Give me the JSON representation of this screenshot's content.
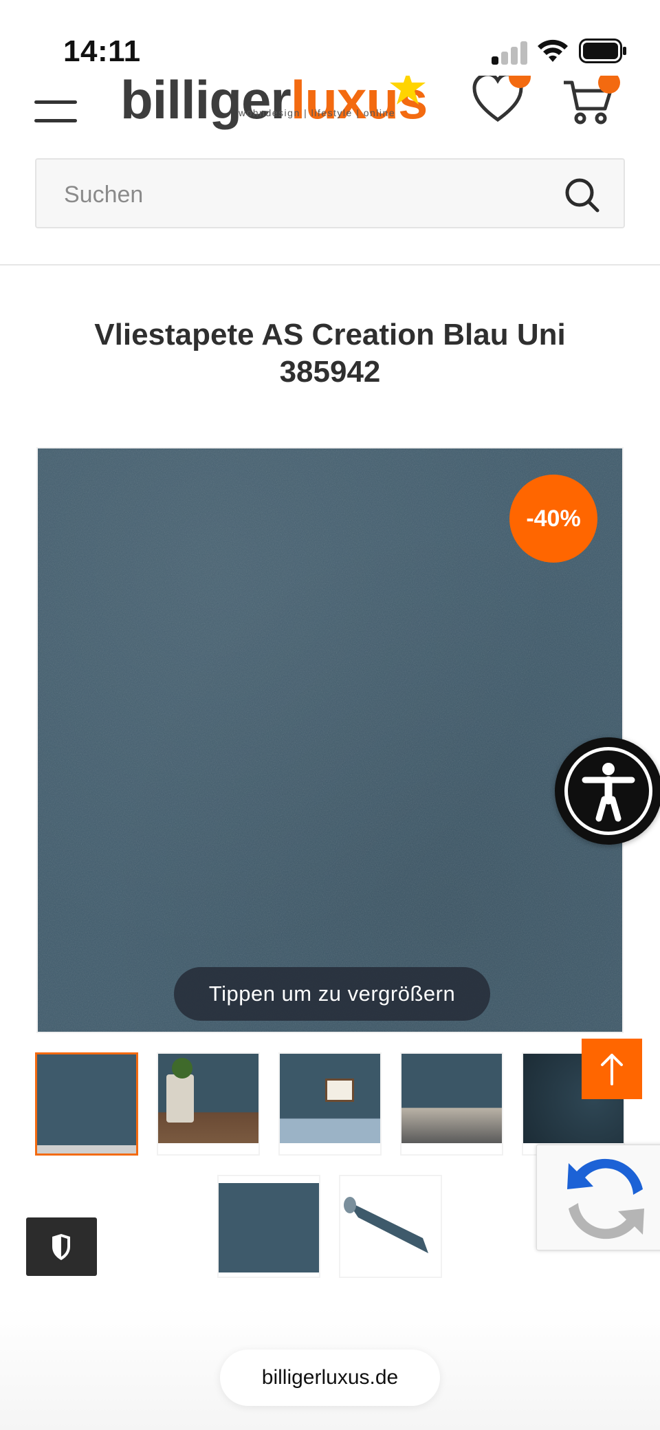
{
  "status_bar": {
    "time": "14:11"
  },
  "header": {
    "logo": {
      "part1": "billiger",
      "part2": "luxus",
      "tagline": "wohndesign | lifestyle | online"
    }
  },
  "search": {
    "placeholder": "Suchen"
  },
  "product": {
    "title": "Vliestapete AS Creation Blau Uni 385942",
    "discount": "-40%",
    "zoom_hint": "Tippen um zu vergrößern"
  },
  "colors": {
    "accent": "#f36a10",
    "wallpaper": "#3e5a6b"
  },
  "browser": {
    "url": "billigerluxus.de"
  }
}
